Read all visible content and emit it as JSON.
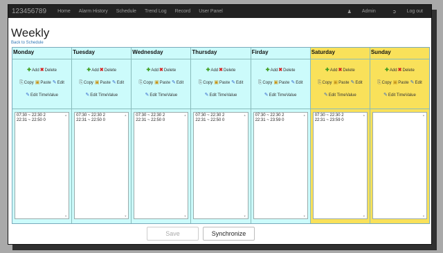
{
  "navbar": {
    "brand": "123456789",
    "links": [
      "Home",
      "Alarm History",
      "Schedule",
      "Trend Log",
      "Record",
      "User Panel"
    ],
    "admin": "Admin",
    "logout": "Log out"
  },
  "page": {
    "title": "Weekly",
    "back_link": "Back to Schedule"
  },
  "actions": {
    "add": "Add",
    "delete": "Delete",
    "copy": "Copy",
    "paste": "Paste",
    "edit": "Edit",
    "edit_time": "Edit TimeValue"
  },
  "days": [
    {
      "name": "Monday",
      "entries": [
        "07:30 ~ 22:30 2",
        "22:31 ~ 22:50 0"
      ],
      "weekend": false
    },
    {
      "name": "Tuesday",
      "entries": [
        "07:30 ~ 22:30 2",
        "22:31 ~ 22:50 0"
      ],
      "weekend": false
    },
    {
      "name": "Wednesday",
      "entries": [
        "07:30 ~ 22:30 2",
        "22:31 ~ 22:50 0"
      ],
      "weekend": false
    },
    {
      "name": "Thursday",
      "entries": [
        "07:30 ~ 22:30 2",
        "22:31 ~ 22:50 0"
      ],
      "weekend": false
    },
    {
      "name": "Firday",
      "entries": [
        "07:30 ~ 22:30 2",
        "22:31 ~ 23:59 0"
      ],
      "weekend": false
    },
    {
      "name": "Saturday",
      "entries": [
        "07:30 ~ 22:30 2",
        "22:31 ~ 23:59 0"
      ],
      "weekend": true
    },
    {
      "name": "Sunday",
      "entries": [],
      "weekend": true
    }
  ],
  "colors": {
    "weekday_bg": "#ccfbfb",
    "weekend_bg": "#f9e15a",
    "navbar_bg": "#222222"
  },
  "buttons": {
    "save": "Save",
    "synchronize": "Synchronize"
  }
}
